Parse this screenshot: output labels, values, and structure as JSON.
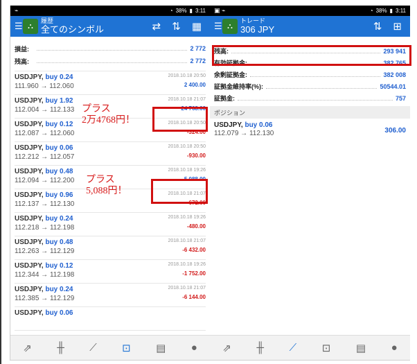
{
  "left": {
    "status": {
      "time": "3:11",
      "battery": "38%"
    },
    "header": {
      "subtitle": "履歴",
      "title": "全てのシンボル"
    },
    "summary": [
      {
        "label": "損益:",
        "value": "2 772"
      },
      {
        "label": "残高:",
        "value": "2 772"
      }
    ],
    "deals": [
      {
        "symbol": "USDJPY,",
        "side": "buy 0.24",
        "prices": "111.960 → 112.060",
        "time": "2018.10.18 20:50",
        "pnl": "2 400.00",
        "sign": "pos"
      },
      {
        "symbol": "USDJPY,",
        "side": "buy 1.92",
        "prices": "112.004 → 112.133",
        "time": "2018.10.18 21:07",
        "pnl": "24 768.00",
        "sign": "pos"
      },
      {
        "symbol": "USDJPY,",
        "side": "buy 0.12",
        "prices": "112.087 → 112.060",
        "time": "2018.10.18 20:50",
        "pnl": "-324.00",
        "sign": "neg"
      },
      {
        "symbol": "USDJPY,",
        "side": "buy 0.06",
        "prices": "112.212 → 112.057",
        "time": "2018.10.18 20:50",
        "pnl": "-930.00",
        "sign": "neg"
      },
      {
        "symbol": "USDJPY,",
        "side": "buy 0.48",
        "prices": "112.094 → 112.200",
        "time": "2018.10.18 19:26",
        "pnl": "5 088.00",
        "sign": "pos"
      },
      {
        "symbol": "USDJPY,",
        "side": "buy 0.96",
        "prices": "112.137 → 112.130",
        "time": "2018.10.18 21:07",
        "pnl": "-672.00",
        "sign": "neg"
      },
      {
        "symbol": "USDJPY,",
        "side": "buy 0.24",
        "prices": "112.218 → 112.198",
        "time": "2018.10.18 19:26",
        "pnl": "-480.00",
        "sign": "neg"
      },
      {
        "symbol": "USDJPY,",
        "side": "buy 0.48",
        "prices": "112.263 → 112.129",
        "time": "2018.10.18 21:07",
        "pnl": "-6 432.00",
        "sign": "neg"
      },
      {
        "symbol": "USDJPY,",
        "side": "buy 0.12",
        "prices": "112.344 → 112.198",
        "time": "2018.10.18 19:26",
        "pnl": "-1 752.00",
        "sign": "neg"
      },
      {
        "symbol": "USDJPY,",
        "side": "buy 0.24",
        "prices": "112.385 → 112.129",
        "time": "2018.10.18 21:07",
        "pnl": "-6 144.00",
        "sign": "neg"
      },
      {
        "symbol": "USDJPY,",
        "side": "buy 0.06",
        "prices": "",
        "time": "",
        "pnl": "",
        "sign": "neg"
      }
    ],
    "annotations": [
      {
        "line1": "プラス",
        "line2": "2万4768円！"
      },
      {
        "line1": "プラス",
        "line2": "5,088円！"
      }
    ]
  },
  "right": {
    "status": {
      "time": "3:11",
      "battery": "38%"
    },
    "header": {
      "subtitle": "トレード",
      "title": "306 JPY"
    },
    "summary": [
      {
        "label": "残高:",
        "value": "293 941"
      },
      {
        "label": "有効証拠金:",
        "value": "382 765"
      },
      {
        "label": "余剰証拠金:",
        "value": "382 008"
      },
      {
        "label": "証拠金維持率(%):",
        "value": "50544.01"
      },
      {
        "label": "証拠金:",
        "value": "757"
      }
    ],
    "section_label": "ポジション",
    "position": {
      "symbol": "USDJPY,",
      "side": "buy 0.06",
      "prices": "112.079 → 112.130",
      "pnl": "306.00"
    }
  },
  "colors": {
    "appbar": "#1f73d4",
    "positive": "#1f5fcf",
    "negative": "#d21a1a",
    "highlight": "#d11010"
  }
}
